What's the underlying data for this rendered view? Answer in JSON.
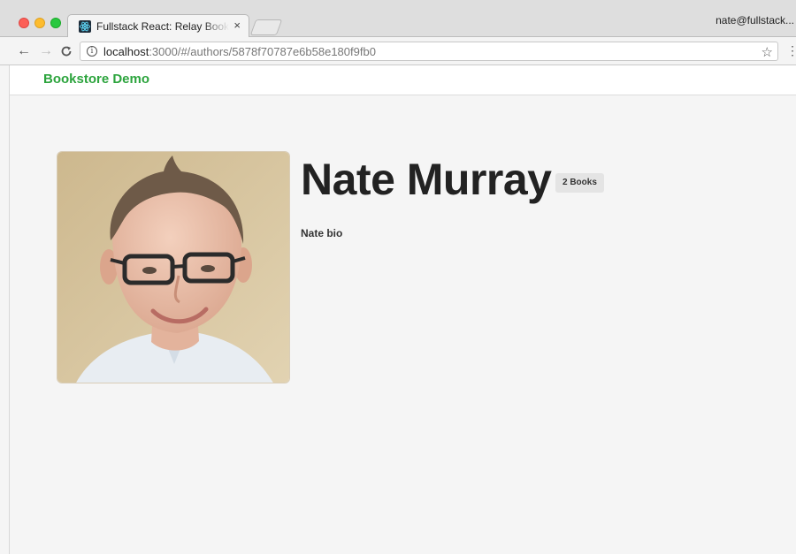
{
  "browser": {
    "tab_title": "Fullstack React: Relay Bookstore",
    "tab_close": "×",
    "profile": "nate@fullstack...",
    "url_host": "localhost",
    "url_rest": ":3000/#/authors/5878f70787e6b58e180f9fb0",
    "icons": {
      "back": "arrow-left-icon",
      "forward": "arrow-right-icon",
      "reload": "reload-icon",
      "info": "info-icon",
      "star": "star-icon",
      "menu": "more-vert-icon"
    }
  },
  "app": {
    "brand": "Bookstore Demo",
    "brand_color": "#2ca43d"
  },
  "author": {
    "name": "Nate Murray",
    "books_badge": "2 Books",
    "bio": "Nate bio"
  }
}
